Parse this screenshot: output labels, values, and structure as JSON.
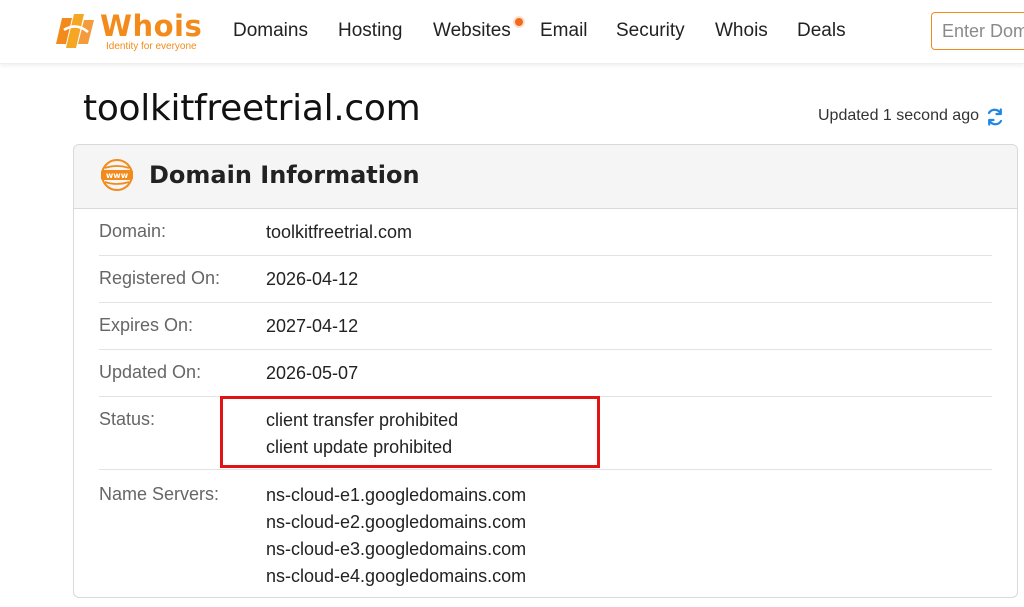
{
  "header": {
    "logo": {
      "word": "Whois",
      "tagline": "Identity for everyone"
    },
    "nav": [
      "Domains",
      "Hosting",
      "Websites",
      "Email",
      "Security",
      "Whois",
      "Deals"
    ],
    "search_placeholder": "Enter Domain"
  },
  "page": {
    "title": "toolkitfreetrial.com",
    "updated": "Updated 1 second ago"
  },
  "card": {
    "title": "Domain Information",
    "icon_text": "www",
    "rows": [
      {
        "label": "Domain:",
        "values": [
          "toolkitfreetrial.com"
        ]
      },
      {
        "label": "Registered On:",
        "values": [
          "2026-04-12"
        ]
      },
      {
        "label": "Expires On:",
        "values": [
          "2027-04-12"
        ]
      },
      {
        "label": "Updated On:",
        "values": [
          "2026-05-07"
        ]
      },
      {
        "label": "Status:",
        "values": [
          "client transfer prohibited",
          "client update prohibited"
        ]
      },
      {
        "label": "Name Servers:",
        "values": [
          "ns-cloud-e1.googledomains.com",
          "ns-cloud-e2.googledomains.com",
          "ns-cloud-e3.googledomains.com",
          "ns-cloud-e4.googledomains.com"
        ]
      }
    ]
  },
  "colors": {
    "brand": "#f28b1b",
    "highlight": "#e01414",
    "refresh": "#1e88e5"
  }
}
